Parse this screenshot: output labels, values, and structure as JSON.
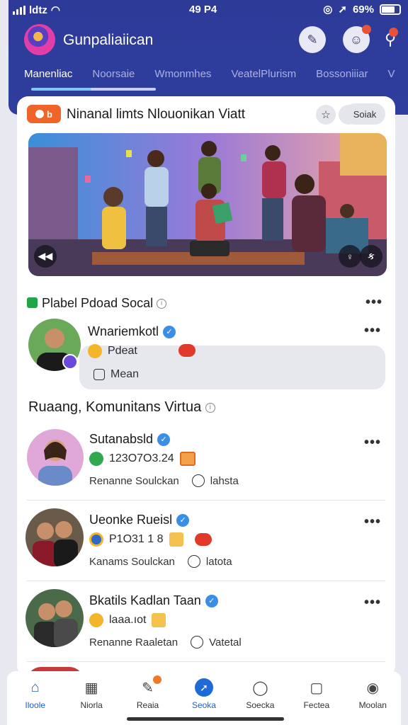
{
  "status_bar": {
    "carrier": "ldtz",
    "time": "49 P4",
    "battery": "69%"
  },
  "header": {
    "app_title": "Gunpaliaiican",
    "tabs": [
      {
        "label": "Manenliac",
        "active": true
      },
      {
        "label": "Noorsaie",
        "active": false
      },
      {
        "label": "Wmonmhes",
        "active": false
      },
      {
        "label": "VeatelPlurism",
        "active": false
      },
      {
        "label": "Bossoniiiar",
        "active": false
      },
      {
        "label": "V",
        "active": false
      }
    ]
  },
  "feature": {
    "badge_label": "b",
    "title": "Ninanal limts   Nlouonikan Viatt",
    "save_label": "Soiak",
    "icon_label": "ક"
  },
  "hero": {
    "prev_label": "◀◀",
    "next_label": "ક"
  },
  "section_1": {
    "title": "Plabel Pdoad Socal"
  },
  "post_1": {
    "name": "Wnariemkotl",
    "meta": "Pdeat",
    "reply_label": "Mean"
  },
  "section_2": {
    "title": "Ruaang, Komunitans Virtua"
  },
  "users": [
    {
      "name": "Sutanabsld",
      "meta": "123O7O3.24",
      "sub_left": "Renanne Soulckan",
      "sub_right": "lahsta"
    },
    {
      "name": "Ueonke Rueisl",
      "meta": "P1O31 1 8",
      "sub_left": "Kanams Soulckan",
      "sub_right": "latota"
    },
    {
      "name": "Bkatils Kadlan Taan",
      "meta": "laaa.ıot",
      "sub_left": "Renanne Raaletan",
      "sub_right": "Vatetal"
    }
  ],
  "bottom_nav": [
    {
      "label": "Iloole",
      "icon": "home-icon",
      "active": true
    },
    {
      "label": "Niorla",
      "icon": "calendar-icon",
      "active": false
    },
    {
      "label": "Reaia",
      "icon": "megaphone-icon",
      "active": false
    },
    {
      "label": "Seoka",
      "icon": "compass-icon",
      "active": true
    },
    {
      "label": "Soecka",
      "icon": "chat-icon",
      "active": false
    },
    {
      "label": "Fectea",
      "icon": "clipboard-icon",
      "active": false
    },
    {
      "label": "Moolan",
      "icon": "profile-icon",
      "active": false
    }
  ],
  "colors": {
    "header_bg": "#2f3e9e",
    "accent_blue": "#1e5fd0",
    "live_orange": "#f0642a",
    "verified_blue": "#3b8ee6"
  }
}
